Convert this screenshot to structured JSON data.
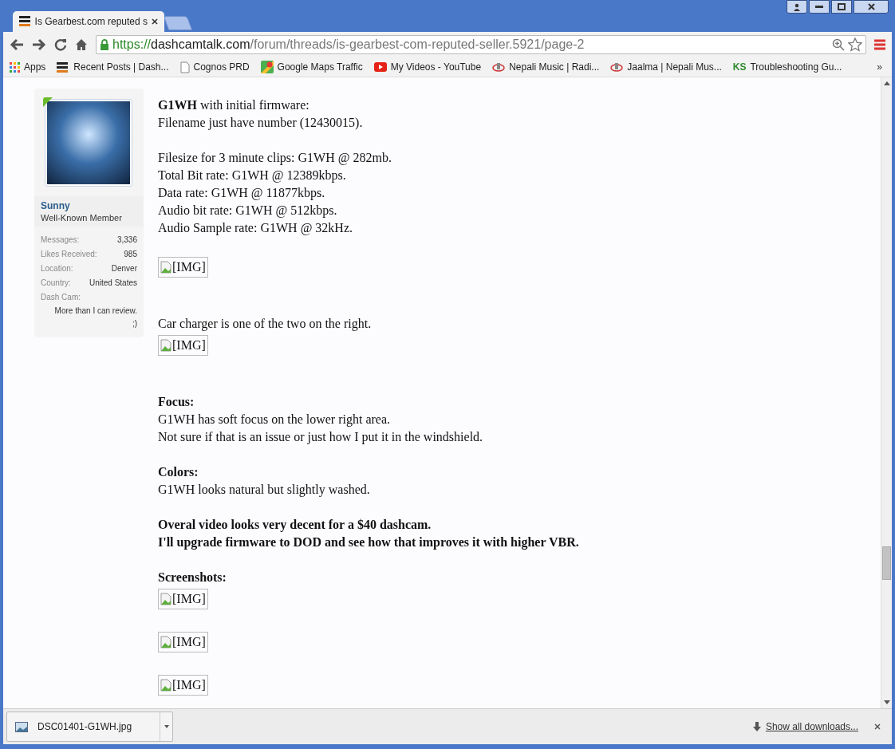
{
  "tabs": [
    {
      "label": "Is Gearbest.com reputed s",
      "selected": true
    }
  ],
  "address_bar": {
    "scheme": "https://",
    "host": "dashcamtalk.com",
    "path": "/forum/threads/is-gearbest-com-reputed-seller.5921/page-2"
  },
  "bookmarks": [
    {
      "label": "Apps",
      "kind": "apps"
    },
    {
      "label": "Recent Posts | Dash...",
      "kind": "dashcam"
    },
    {
      "label": "Cognos PRD",
      "kind": "page"
    },
    {
      "label": "Google Maps Traffic",
      "kind": "maps"
    },
    {
      "label": "My Videos - YouTube",
      "kind": "youtube"
    },
    {
      "label": "Nepali Music | Radi...",
      "kind": "radio"
    },
    {
      "label": "Jaalma | Nepali Mus...",
      "kind": "radio"
    },
    {
      "label": "Troubleshooting Gu...",
      "kind": "ks",
      "logo_text": "KS"
    }
  ],
  "more_bookmarks": "»",
  "author": {
    "name": "Sunny",
    "title": "Well-Known Member",
    "stats": [
      {
        "label": "Messages:",
        "value": "3,336"
      },
      {
        "label": "Likes Received:",
        "value": "985"
      },
      {
        "label": "Location:",
        "value": "Denver"
      },
      {
        "label": "Country:",
        "value": "United States"
      },
      {
        "label": "Dash Cam:",
        "value": "More than I can review. ;)"
      }
    ]
  },
  "post": [
    {
      "kind": "line",
      "text": "**G1WH** with initial firmware:",
      "bold": false
    },
    {
      "kind": "line",
      "text": "Filename just have number (12430015).",
      "bold": false
    },
    {
      "kind": "gap"
    },
    {
      "kind": "line",
      "text": "Filesize for 3 minute clips: G1WH @ 282mb.",
      "bold": false
    },
    {
      "kind": "line",
      "text": "Total Bit rate: G1WH @ 12389kbps.",
      "bold": false
    },
    {
      "kind": "line",
      "text": "Data rate: G1WH @ 11877kbps.",
      "bold": false
    },
    {
      "kind": "line",
      "text": "Audio bit rate: G1WH @ 512kbps.",
      "bold": false
    },
    {
      "kind": "line",
      "text": "Audio Sample rate: G1WH @ 32kHz.",
      "bold": false
    },
    {
      "kind": "gap"
    },
    {
      "kind": "image",
      "alt": "[IMG]"
    },
    {
      "kind": "gap"
    },
    {
      "kind": "gap"
    },
    {
      "kind": "line",
      "text": "Car charger is one of the two on the right.",
      "bold": false
    },
    {
      "kind": "image",
      "alt": "[IMG]"
    },
    {
      "kind": "gap"
    },
    {
      "kind": "gap"
    },
    {
      "kind": "line",
      "text": "Focus:",
      "bold": true
    },
    {
      "kind": "line",
      "text": "G1WH has soft focus on the lower right area.",
      "bold": false
    },
    {
      "kind": "line",
      "text": "Not sure if that is an issue or just how I put it in the windshield.",
      "bold": false
    },
    {
      "kind": "gap"
    },
    {
      "kind": "line",
      "text": "Colors:",
      "bold": true
    },
    {
      "kind": "line",
      "text": "G1WH looks natural but slightly washed.",
      "bold": false
    },
    {
      "kind": "gap"
    },
    {
      "kind": "line",
      "text": "Overal video looks very decent for a $40 dashcam.",
      "bold": true
    },
    {
      "kind": "line",
      "text": "I'll upgrade firmware to DOD and see how that improves it with higher VBR.",
      "bold": true
    },
    {
      "kind": "gap"
    },
    {
      "kind": "line",
      "text": "Screenshots:",
      "bold": true
    },
    {
      "kind": "image",
      "alt": "[IMG]"
    },
    {
      "kind": "gap"
    },
    {
      "kind": "image",
      "alt": "[IMG]"
    },
    {
      "kind": "gap"
    },
    {
      "kind": "image",
      "alt": "[IMG]"
    }
  ],
  "downloads": {
    "items": [
      {
        "filename": "DSC01401-G1WH.jpg"
      }
    ],
    "show_all": "Show all downloads..."
  }
}
